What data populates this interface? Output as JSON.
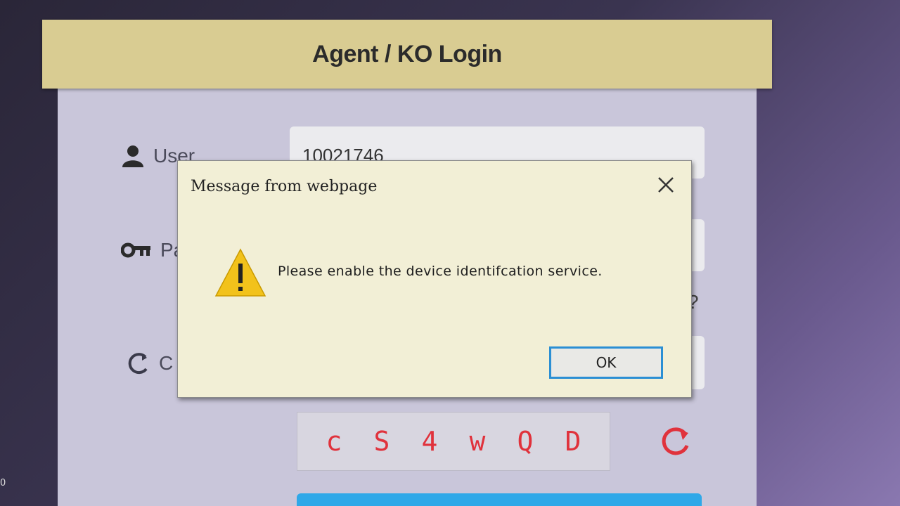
{
  "login": {
    "title": "Agent / KO Login",
    "user_label": "User",
    "user_value": "10021746",
    "password_label_partial": "Pa",
    "captcha_label_partial": "C",
    "forgot_partial": "?",
    "captcha_chars": [
      "c",
      "S",
      "4",
      "w",
      "Q",
      "D"
    ]
  },
  "dialog": {
    "title": "Message from webpage",
    "message": "Please enable the device identifcation service.",
    "ok_label": "OK",
    "icon": "warning-icon",
    "close_icon": "close-icon"
  },
  "edge_label": "0",
  "colors": {
    "header_bg": "#d9cc92",
    "dialog_bg": "#f2efd6",
    "ok_border": "#2b8fd4",
    "captcha_text": "#e0323c",
    "submit": "#2fa8e8"
  }
}
